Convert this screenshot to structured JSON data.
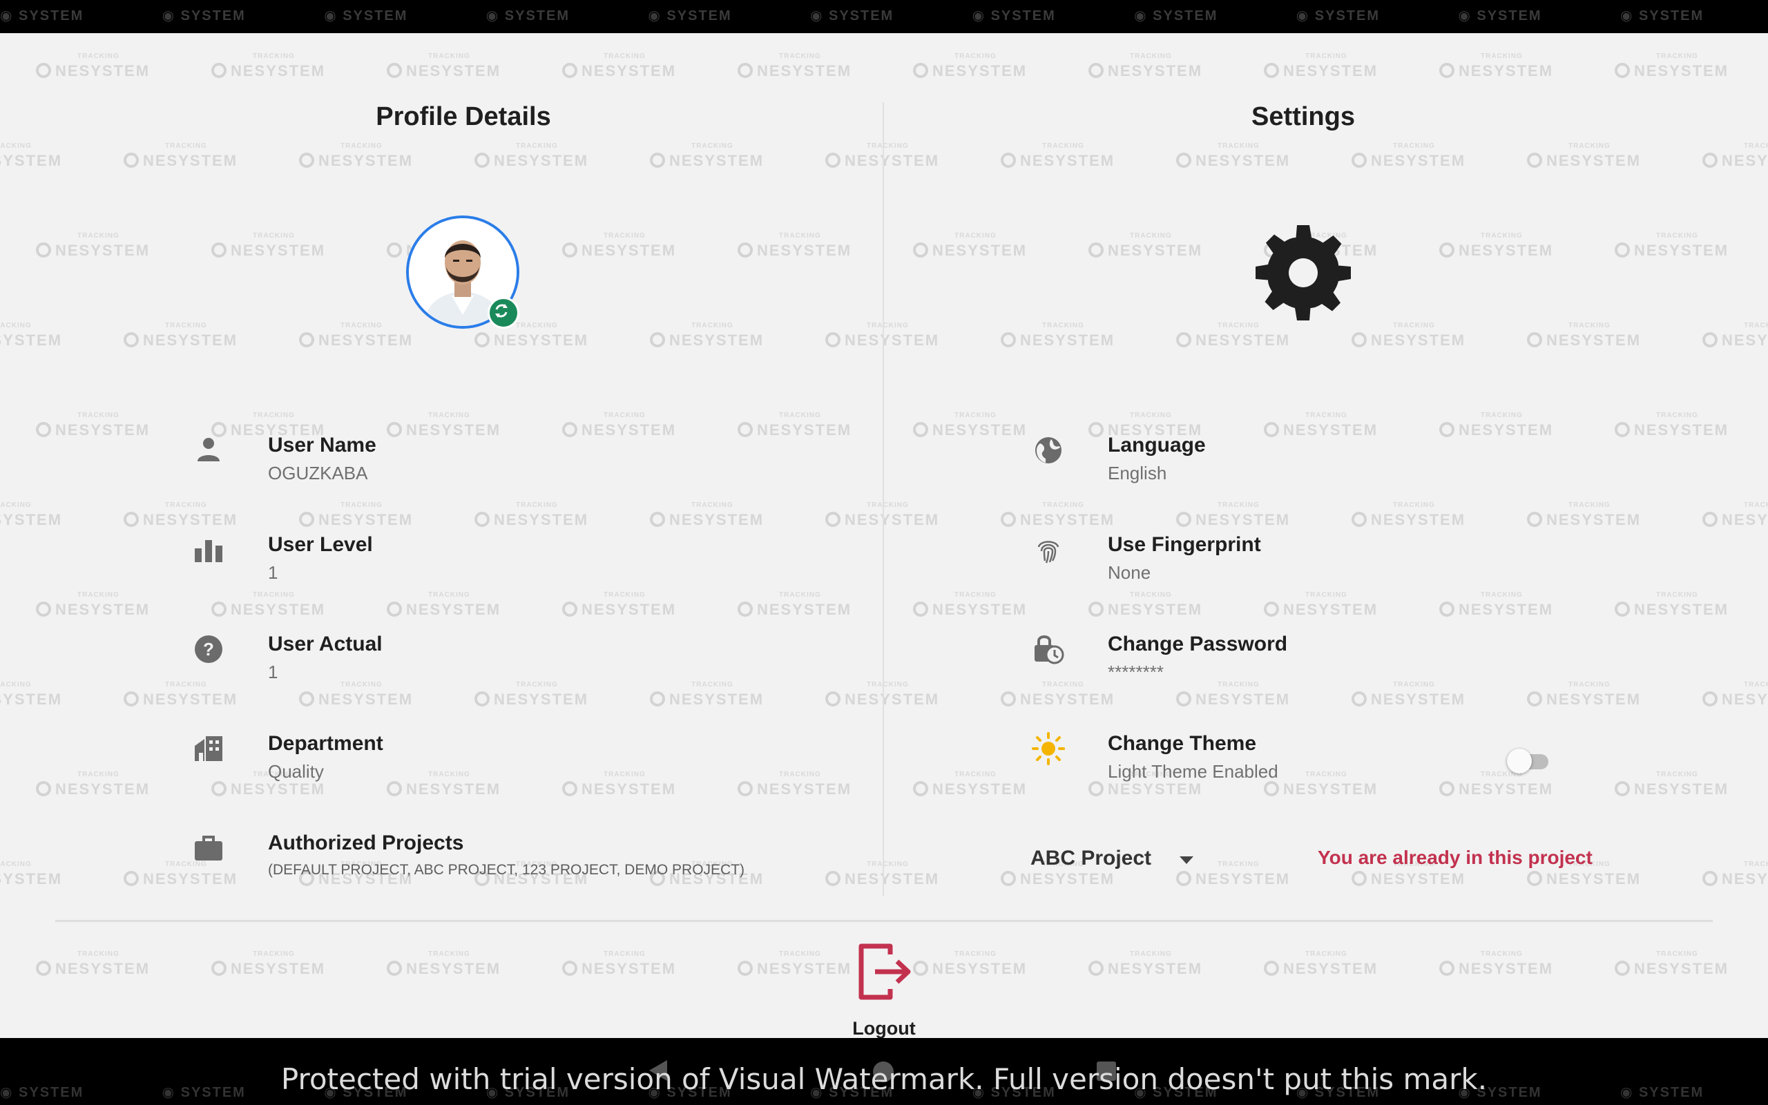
{
  "watermark": {
    "small": "TRACKING",
    "brand": "NESYSTEM",
    "strip": "SYSTEM"
  },
  "profile": {
    "title": "Profile Details",
    "fields": [
      {
        "icon": "person-icon",
        "label": "User Name",
        "value": "OGUZKABA"
      },
      {
        "icon": "bar-chart-icon",
        "label": "User Level",
        "value": "1"
      },
      {
        "icon": "help-circle-icon",
        "label": "User Actual",
        "value": "1"
      },
      {
        "icon": "department-icon",
        "label": "Department",
        "value": "Quality"
      },
      {
        "icon": "briefcase-icon",
        "label": "Authorized Projects",
        "value": "(DEFAULT PROJECT, ABC PROJECT, 123 PROJECT, DEMO PROJECT)"
      }
    ]
  },
  "settings": {
    "title": "Settings",
    "items": [
      {
        "icon": "globe-icon",
        "label": "Language",
        "value": "English"
      },
      {
        "icon": "fingerprint-icon",
        "label": "Use Fingerprint",
        "value": "None"
      },
      {
        "icon": "lock-clock-icon",
        "label": "Change Password",
        "value": "********"
      },
      {
        "icon": "sun-icon",
        "label": "Change Theme",
        "value": "Light Theme Enabled"
      }
    ],
    "theme_toggle_on": false,
    "project_selected": "ABC Project",
    "project_note": "You are already in this project"
  },
  "logout": {
    "label": "Logout"
  },
  "trial_notice": "Protected with trial version of Visual Watermark. Full version doesn't put this mark.",
  "colors": {
    "accent_blue": "#2b7de9",
    "badge_green": "#1b8a5a",
    "logout_red": "#c2324f",
    "sun_yellow": "#f4b400"
  }
}
